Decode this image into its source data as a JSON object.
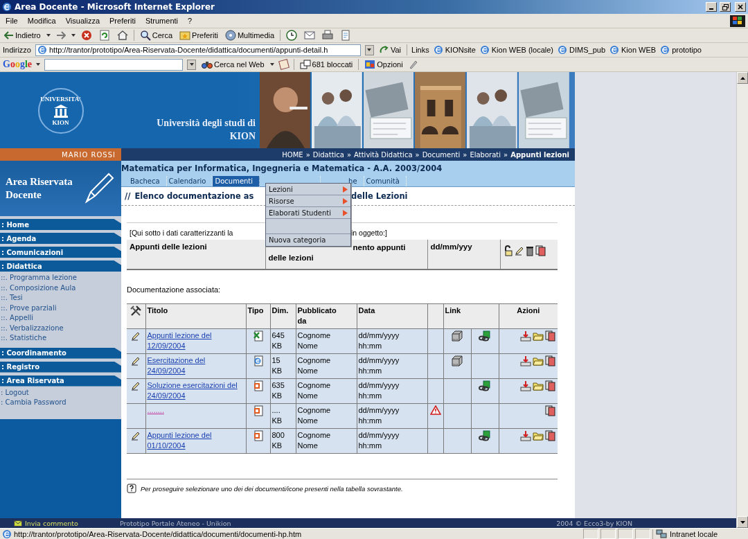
{
  "window": {
    "title": "Area Docente - Microsoft Internet Explorer"
  },
  "menu_bar": [
    "File",
    "Modifica",
    "Visualizza",
    "Preferiti",
    "Strumenti",
    "?"
  ],
  "toolbar": [
    {
      "kind": "back",
      "label": "Indietro"
    },
    {
      "kind": "forward"
    },
    {
      "kind": "stop"
    },
    {
      "kind": "refresh"
    },
    {
      "kind": "home"
    },
    {
      "kind": "search",
      "label": "Cerca"
    },
    {
      "kind": "favorites",
      "label": "Preferiti"
    },
    {
      "kind": "media",
      "label": "Multimedia"
    },
    {
      "kind": "history"
    },
    {
      "kind": "mail"
    },
    {
      "kind": "print"
    },
    {
      "kind": "edit"
    }
  ],
  "address_bar": {
    "label": "Indirizzo",
    "url": "http://trantor/prototipo/Area-Riservata-Docente/didattica/documenti/appunti-detail.h",
    "go": "Vai",
    "links_label": "Links",
    "links": [
      "KIONsite",
      "Kion WEB (locale)",
      "DIMS_pub",
      "Kion WEB",
      "prototipo"
    ]
  },
  "google_bar": {
    "logo": "Google",
    "search_button": "Cerca nel Web",
    "blocked": "681 bloccati",
    "options": "Opzioni"
  },
  "header": {
    "logo_top": "UNIVERSITA'",
    "logo_bottom": "KION",
    "title_line_1": "Università degli studi di",
    "title_line_2": "KION"
  },
  "user_name": "MARIO ROSSI",
  "breadcrumb_separator": "»",
  "breadcrumb": [
    {
      "label": "HOME",
      "current": false
    },
    {
      "label": "Didattica",
      "current": false
    },
    {
      "label": "Attività Didattica",
      "current": false
    },
    {
      "label": "Documenti",
      "current": false
    },
    {
      "label": "Elaborati",
      "current": false
    },
    {
      "label": "Appunti lezioni",
      "current": true
    }
  ],
  "sidebar": {
    "title_line_1": "Area Riservata",
    "title_line_2": "Docente",
    "sections": [
      {
        "label": ": Home"
      },
      {
        "label": ": Agenda"
      },
      {
        "label": ": Comunicazioni"
      },
      {
        "label": ": Didattica",
        "children": [
          "::. Programma lezione",
          "::. Composizione Aula",
          "::. Tesi",
          "::. Prove parziali",
          "::. Appelli",
          "::. Verbalizzazione",
          "::. Statistiche"
        ]
      },
      {
        "label": ": Coordinamento"
      },
      {
        "label": ": Registro"
      },
      {
        "label": ": Area Riservata",
        "children": [
          ": Logout",
          ": Cambia Password"
        ]
      }
    ]
  },
  "course_title": "Matematica per Informatica, Ingegneria e Matematica - A.A. 2003/2004",
  "tabs": [
    {
      "label": "Bacheca",
      "selected": false
    },
    {
      "label": "Calendario",
      "selected": false
    },
    {
      "label": "Documenti",
      "selected": true
    },
    {
      "selected": false
    },
    {
      "label": "he",
      "selected": false
    },
    {
      "label": "Comunità",
      "selected": false
    }
  ],
  "heading": {
    "marker": "//",
    "text_start": "Elenco documentazione as",
    "text_end": "delle Lezioni"
  },
  "dropdown_menu": [
    {
      "kind": "item",
      "label": "Lezioni",
      "submenu": true
    },
    {
      "kind": "item",
      "label": "Risorse",
      "submenu": true
    },
    {
      "kind": "item",
      "label": "Elaborati Studenti",
      "submenu": true
    },
    {
      "kind": "blank"
    },
    {
      "kind": "item",
      "label": "Nuova categoria",
      "submenu": false
    }
  ],
  "info": {
    "note_start": "[Qui sotto i dati caratterizzanti la",
    "note_end": "in oggetto:]",
    "title": "Appunti delle lezioni",
    "description_line_1": "nento appunti",
    "description_line_2": "delle lezioni",
    "date": "dd/mm/yyy"
  },
  "documents": {
    "label": "Documentazione associata:",
    "columns": [
      "Titolo",
      "Tipo",
      "Dim.",
      "Pubblicato da",
      "Data",
      "Link",
      "Azioni"
    ],
    "rows": [
      {
        "editable": true,
        "title": "Appunti lezione del 12/09/2004",
        "incomplete": false,
        "kind": "spreadsheet",
        "size": "645 KB",
        "author": "Cognome Nome",
        "date": "dd/mm/yyyy hh:mm",
        "warning": false,
        "server_link": true,
        "web_link": true,
        "download": true,
        "open": true,
        "copy": true
      },
      {
        "editable": true,
        "title": "Esercitazione del 24/09/2004",
        "incomplete": false,
        "kind": "web_page",
        "size": "15 KB",
        "author": "Cognome Nome",
        "date": "dd/mm/yyyy hh:mm",
        "warning": false,
        "server_link": true,
        "web_link": false,
        "download": true,
        "open": true,
        "copy": true
      },
      {
        "editable": true,
        "title": "Soluzione esercitazioni del 24/09/2004",
        "incomplete": false,
        "kind": "presentation",
        "size": "635 KB",
        "author": "Cognome Nome",
        "date": "dd/mm/yyyy hh:mm",
        "warning": false,
        "server_link": false,
        "web_link": true,
        "download": true,
        "open": true,
        "copy": true
      },
      {
        "editable": false,
        "title": "........",
        "incomplete": true,
        "kind": "presentation",
        "size": ".... KB",
        "author": "Cognome Nome",
        "date": "dd/mm/yyyy hh:mm",
        "warning": true,
        "server_link": false,
        "web_link": false,
        "download": false,
        "open": false,
        "copy": true
      },
      {
        "editable": true,
        "title": "Appunti lezione del 01/10/2004",
        "incomplete": false,
        "kind": "presentation",
        "size": "800 KB",
        "author": "Cognome Nome",
        "date": "dd/mm/yyyy hh:mm",
        "warning": false,
        "server_link": false,
        "web_link": true,
        "download": true,
        "open": true,
        "copy": true
      }
    ]
  },
  "hint": "Per proseguire selezionare uno dei dei documenti/icone presenti nella tabella sovrastante.",
  "footer": {
    "comment": "Invia commento",
    "project": "Prototipo Portale Ateneo - Unikion",
    "copyright": "2004 © Ecco3-by KION"
  },
  "status_bar": {
    "url": "http://trantor/prototipo/Area-Riservata-Docente/didattica/documenti/documenti-hp.htm",
    "zone": "Intranet locale"
  }
}
